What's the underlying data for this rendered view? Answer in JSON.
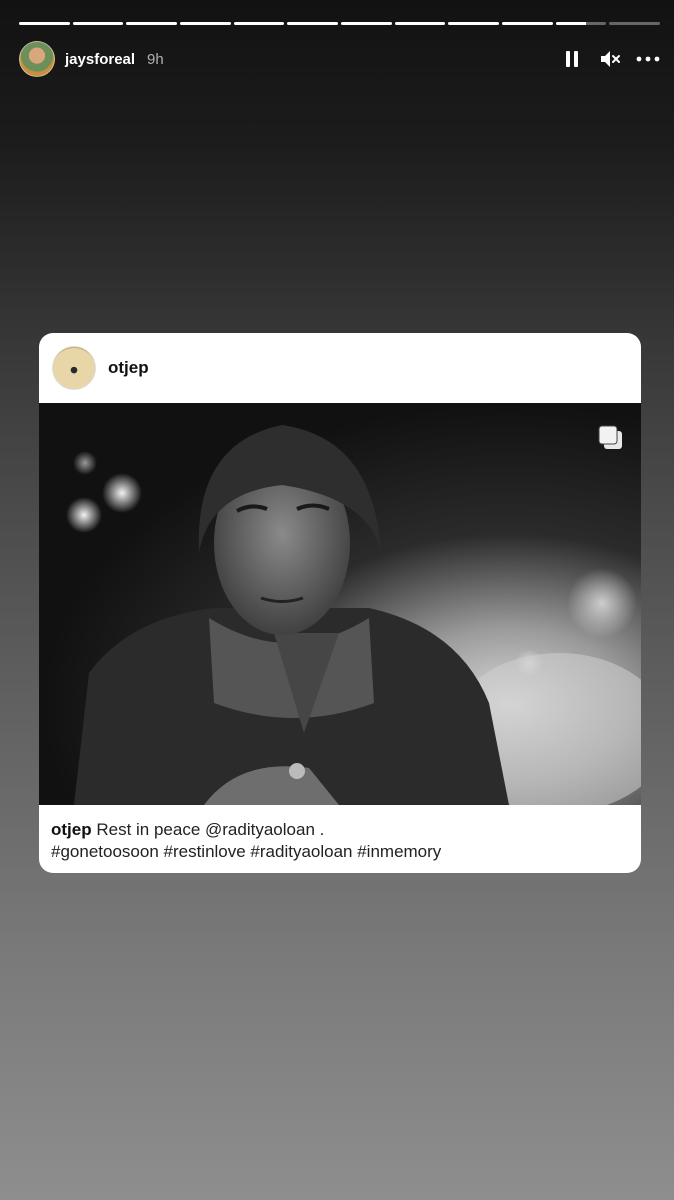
{
  "story": {
    "segments": [
      1,
      1,
      1,
      1,
      1,
      1,
      1,
      1,
      1,
      1,
      0.6,
      0
    ],
    "user": "jaysforeal",
    "time": "9h",
    "controls": {
      "pause_icon": "pause-icon",
      "mute_icon": "speaker-muted-icon",
      "more_icon": "more-dots-icon"
    }
  },
  "post": {
    "user": "otjep",
    "multi_icon": "multiple-photos-icon",
    "caption_user": "otjep",
    "caption_text": "Rest in peace @radityaoloan .",
    "caption_tags": "#gonetoosoon #restinlove #radityaoloan #inmemory"
  }
}
